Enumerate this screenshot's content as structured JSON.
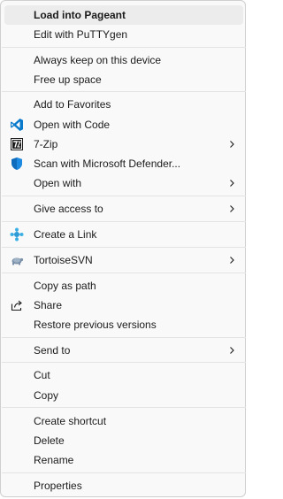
{
  "menu": {
    "items": [
      {
        "label": "Load into Pageant",
        "bold": true
      },
      {
        "label": "Edit with PuTTYgen"
      },
      {
        "label": "Always keep on this device"
      },
      {
        "label": "Free up space"
      },
      {
        "label": "Add to Favorites"
      },
      {
        "label": "Open with Code",
        "icon": "vscode-icon"
      },
      {
        "label": "7-Zip",
        "icon": "7zip-icon",
        "submenu": true
      },
      {
        "label": "Scan with Microsoft Defender...",
        "icon": "defender-shield-icon"
      },
      {
        "label": "Open with",
        "submenu": true
      },
      {
        "label": "Give access to",
        "submenu": true
      },
      {
        "label": "Create a Link",
        "icon": "link-icon"
      },
      {
        "label": "TortoiseSVN",
        "icon": "tortoisesvn-icon",
        "submenu": true
      },
      {
        "label": "Copy as path"
      },
      {
        "label": "Share",
        "icon": "share-icon"
      },
      {
        "label": "Restore previous versions"
      },
      {
        "label": "Send to",
        "submenu": true
      },
      {
        "label": "Cut"
      },
      {
        "label": "Copy"
      },
      {
        "label": "Create shortcut"
      },
      {
        "label": "Delete"
      },
      {
        "label": "Rename"
      },
      {
        "label": "Properties"
      }
    ]
  },
  "colors": {
    "background": "#f9f9f9",
    "text": "#1b1b1b",
    "hover": "#ececec",
    "separator": "#e3e3e3",
    "vscode_blue": "#0a7acc",
    "defender_blue": "#0f6cbd"
  }
}
